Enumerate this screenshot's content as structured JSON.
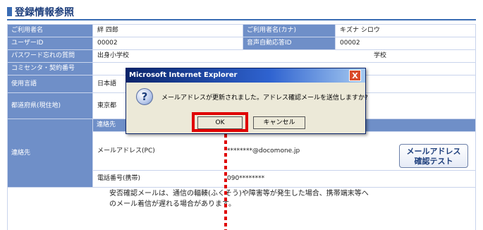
{
  "page_title": "登録情報参照",
  "fields": {
    "name_label": "ご利用者名",
    "name_value": "絆 四郎",
    "kana_label": "ご利用者名(カナ)",
    "kana_value": "キズナ シロウ",
    "user_id_label": "ユーザーID",
    "user_id_value": "00002",
    "voice_id_label": "音声自動応答ID",
    "voice_id_value": "00002",
    "pw_question_label": "パスワード忘れの質問",
    "pw_question_value": "出身小学校",
    "pw_question_value_right": "学校",
    "tel_code_label": "コミセンタ・契約番号",
    "language_label": "使用言語",
    "language_value": "日本語",
    "prefecture_label": "都道府県(現住地)",
    "prefecture_value": "東京都",
    "contact_label": "連絡先",
    "contact_header": "連絡先",
    "mail_pc_label": "メールアドレス(PC)",
    "mail_pc_value": "********@docomone.jp",
    "phone_label": "電話番号(携帯)",
    "phone_value": "090********"
  },
  "mail_test_button": {
    "line1": "メールアドレス",
    "line2": "確認テスト"
  },
  "note": {
    "line1": "安否確認メールは、通信の輻輳(ふくそう)や障害等が発生した場合、携帯端末等へ",
    "line2": "のメール着信が遅れる場合があります。"
  },
  "dialog": {
    "title": "Microsoft Internet Explorer",
    "close": "X",
    "icon": "?",
    "message": "メールアドレスが更新されました。アドレス確認メールを送信しますか?",
    "ok_label": "OK",
    "cancel_label": "キャンセル"
  },
  "colors": {
    "label_bg": "#6f8fc8",
    "title_accent": "#3a6cb4",
    "highlight": "#e00000"
  }
}
